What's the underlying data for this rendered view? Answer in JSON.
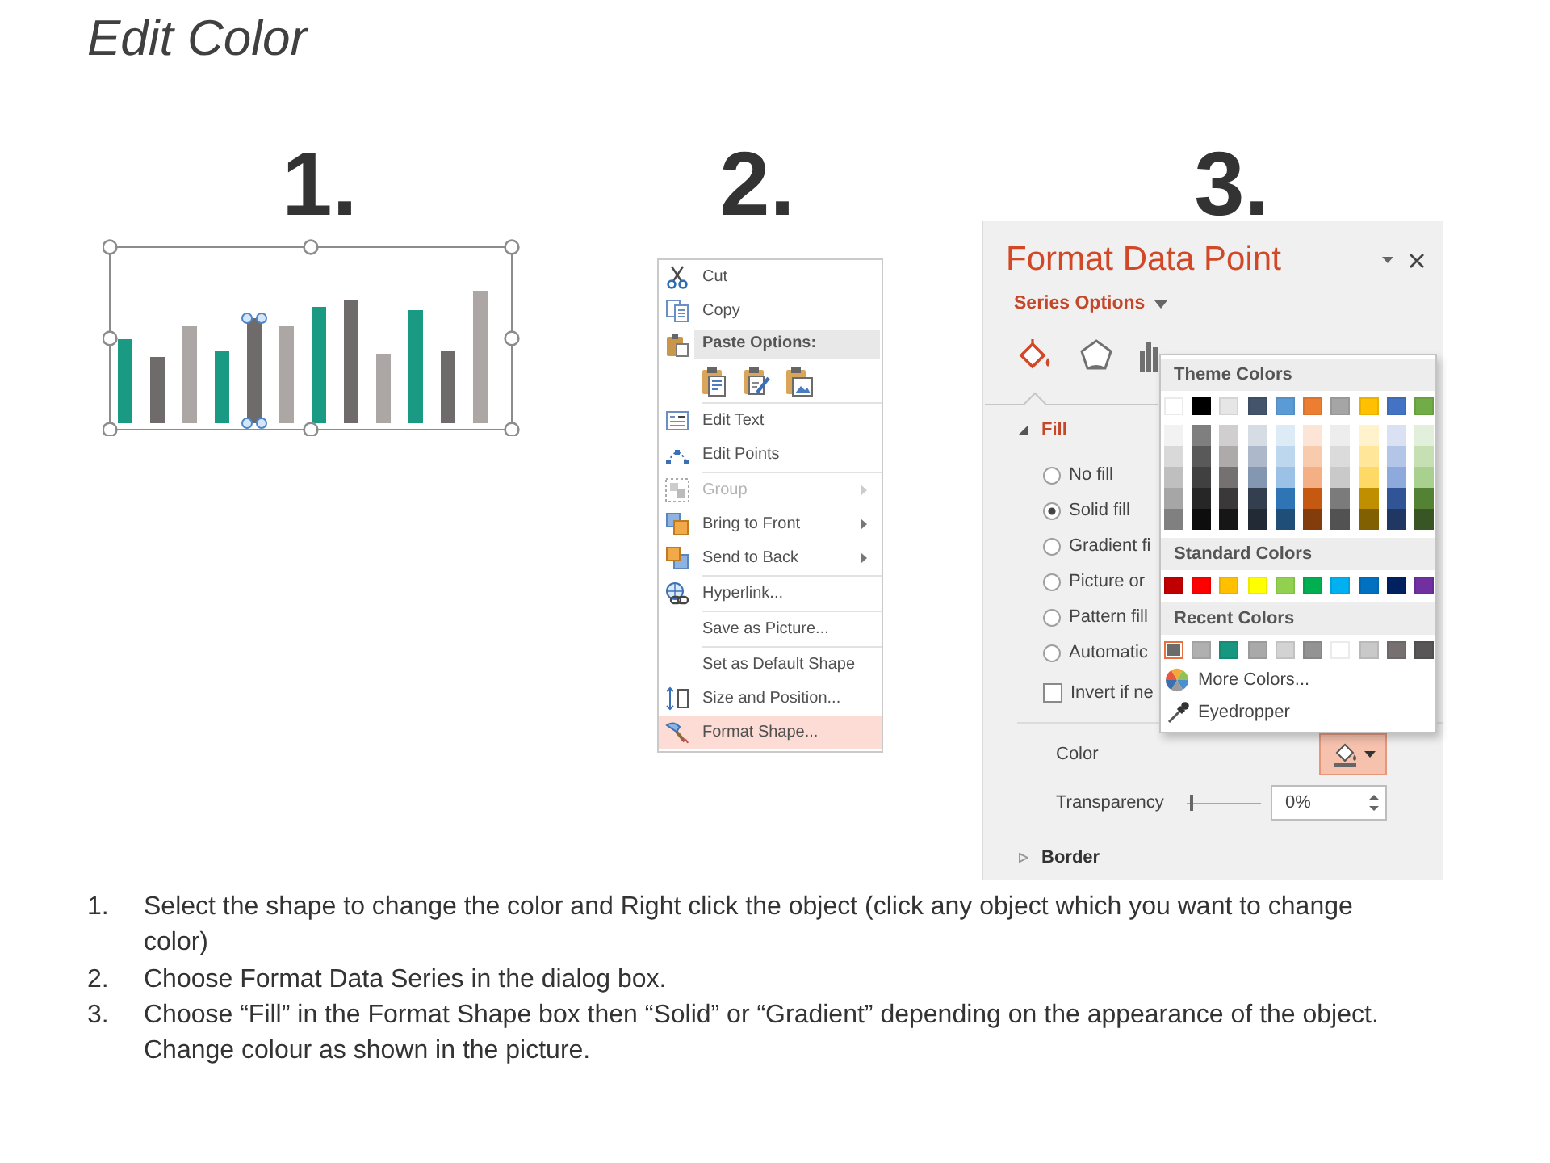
{
  "title": "Edit Color",
  "steps": [
    {
      "number": "1."
    },
    {
      "number": "2.",
      "context_menu": {
        "items": [
          {
            "kind": "item",
            "label": "Cut",
            "disabled": false,
            "submenu": false,
            "selected": false
          },
          {
            "kind": "item",
            "label": "Copy",
            "disabled": false,
            "submenu": false,
            "selected": false
          },
          {
            "kind": "header",
            "label": "Paste Options:"
          },
          {
            "kind": "paste_icons"
          },
          {
            "kind": "separator"
          },
          {
            "kind": "item",
            "label": "Edit Text",
            "disabled": false,
            "submenu": false,
            "selected": false
          },
          {
            "kind": "item",
            "label": "Edit Points",
            "disabled": false,
            "submenu": false,
            "selected": false
          },
          {
            "kind": "separator"
          },
          {
            "kind": "item",
            "label": "Group",
            "disabled": true,
            "submenu": true,
            "selected": false
          },
          {
            "kind": "item",
            "label": "Bring to Front",
            "disabled": false,
            "submenu": true,
            "selected": false
          },
          {
            "kind": "item",
            "label": "Send to Back",
            "disabled": false,
            "submenu": true,
            "selected": false
          },
          {
            "kind": "separator"
          },
          {
            "kind": "item",
            "label": "Hyperlink...",
            "disabled": false,
            "submenu": false,
            "selected": false
          },
          {
            "kind": "separator"
          },
          {
            "kind": "item",
            "label": "Save as Picture...",
            "disabled": false,
            "submenu": false,
            "selected": false
          },
          {
            "kind": "separator"
          },
          {
            "kind": "item",
            "label": "Set as Default Shape",
            "disabled": false,
            "submenu": false,
            "selected": false
          },
          {
            "kind": "item",
            "label": "Size and Position...",
            "disabled": false,
            "submenu": false,
            "selected": false
          },
          {
            "kind": "item",
            "label": "Format Shape...",
            "disabled": false,
            "submenu": false,
            "selected": true
          }
        ]
      }
    },
    {
      "number": "3.",
      "format_pane": {
        "title": "Format Data Point",
        "options_menu": "Series Options",
        "tabs": [
          {
            "selected": true
          },
          {
            "selected": false
          },
          {
            "selected": false
          }
        ],
        "fill": {
          "label": "Fill",
          "expanded": true,
          "options": [
            {
              "kind": "radio",
              "label": "No fill",
              "selected": false
            },
            {
              "kind": "radio",
              "label": "Solid fill",
              "selected": true
            },
            {
              "kind": "radio",
              "label": "Gradient fi",
              "selected": false
            },
            {
              "kind": "radio",
              "label": "Picture or",
              "selected": false
            },
            {
              "kind": "radio",
              "label": "Pattern fill",
              "selected": false
            },
            {
              "kind": "radio",
              "label": "Automatic",
              "selected": false
            },
            {
              "kind": "checkbox",
              "label": "Invert if ne",
              "checked": false
            }
          ],
          "color": {
            "label": "Color",
            "open": true,
            "menu": {
              "theme_colors": {
                "heading": "Theme Colors",
                "swatches": [
                  {
                    "color": "#ffffff",
                    "selected": false,
                    "shades": [
                      {
                        "color": "#f2f2f2",
                        "selected": false
                      },
                      {
                        "color": "#d9d9d9",
                        "selected": false
                      },
                      {
                        "color": "#bfbfbf",
                        "selected": false
                      },
                      {
                        "color": "#a6a6a6",
                        "selected": false
                      },
                      {
                        "color": "#808080",
                        "selected": false
                      }
                    ]
                  },
                  {
                    "color": "#000000",
                    "selected": false,
                    "shades": [
                      {
                        "color": "#7f7f7f",
                        "selected": false
                      },
                      {
                        "color": "#595959",
                        "selected": false
                      },
                      {
                        "color": "#404040",
                        "selected": false
                      },
                      {
                        "color": "#262626",
                        "selected": false
                      },
                      {
                        "color": "#0d0d0d",
                        "selected": false
                      }
                    ]
                  },
                  {
                    "color": "#e7e6e6",
                    "selected": false,
                    "shades": [
                      {
                        "color": "#d0cece",
                        "selected": false
                      },
                      {
                        "color": "#aeaaaa",
                        "selected": false
                      },
                      {
                        "color": "#757171",
                        "selected": false
                      },
                      {
                        "color": "#3a3838",
                        "selected": false
                      },
                      {
                        "color": "#171616",
                        "selected": false
                      }
                    ]
                  },
                  {
                    "color": "#44546a",
                    "selected": false,
                    "shades": [
                      {
                        "color": "#d6dce4",
                        "selected": false
                      },
                      {
                        "color": "#adb9ca",
                        "selected": false
                      },
                      {
                        "color": "#8497b0",
                        "selected": false
                      },
                      {
                        "color": "#333f4f",
                        "selected": false
                      },
                      {
                        "color": "#222a35",
                        "selected": false
                      }
                    ]
                  },
                  {
                    "color": "#5b9bd5",
                    "selected": false,
                    "shades": [
                      {
                        "color": "#ddebf7",
                        "selected": false
                      },
                      {
                        "color": "#bdd7ee",
                        "selected": false
                      },
                      {
                        "color": "#9bc2e6",
                        "selected": false
                      },
                      {
                        "color": "#2f75b5",
                        "selected": false
                      },
                      {
                        "color": "#1f4e78",
                        "selected": false
                      }
                    ]
                  },
                  {
                    "color": "#ed7d31",
                    "selected": false,
                    "shades": [
                      {
                        "color": "#fce4d6",
                        "selected": false
                      },
                      {
                        "color": "#f8cbad",
                        "selected": false
                      },
                      {
                        "color": "#f4b084",
                        "selected": false
                      },
                      {
                        "color": "#c65911",
                        "selected": false
                      },
                      {
                        "color": "#833c0c",
                        "selected": false
                      }
                    ]
                  },
                  {
                    "color": "#a5a5a5",
                    "selected": false,
                    "shades": [
                      {
                        "color": "#ededed",
                        "selected": false
                      },
                      {
                        "color": "#dbdbdb",
                        "selected": false
                      },
                      {
                        "color": "#c9c9c9",
                        "selected": false
                      },
                      {
                        "color": "#7b7b7b",
                        "selected": false
                      },
                      {
                        "color": "#525252",
                        "selected": false
                      }
                    ]
                  },
                  {
                    "color": "#ffc000",
                    "selected": false,
                    "shades": [
                      {
                        "color": "#fff2cc",
                        "selected": false
                      },
                      {
                        "color": "#ffe699",
                        "selected": false
                      },
                      {
                        "color": "#ffd966",
                        "selected": false
                      },
                      {
                        "color": "#bf8f00",
                        "selected": false
                      },
                      {
                        "color": "#806000",
                        "selected": false
                      }
                    ]
                  },
                  {
                    "color": "#4472c4",
                    "selected": false,
                    "shades": [
                      {
                        "color": "#d9e1f2",
                        "selected": false
                      },
                      {
                        "color": "#b4c6e7",
                        "selected": false
                      },
                      {
                        "color": "#8ea9db",
                        "selected": false
                      },
                      {
                        "color": "#305496",
                        "selected": false
                      },
                      {
                        "color": "#203764",
                        "selected": false
                      }
                    ]
                  },
                  {
                    "color": "#70ad47",
                    "selected": false,
                    "shades": [
                      {
                        "color": "#e2efda",
                        "selected": false
                      },
                      {
                        "color": "#c6e0b4",
                        "selected": false
                      },
                      {
                        "color": "#a9d08e",
                        "selected": false
                      },
                      {
                        "color": "#548235",
                        "selected": false
                      },
                      {
                        "color": "#375623",
                        "selected": false
                      }
                    ]
                  }
                ]
              },
              "standard_colors": {
                "heading": "Standard Colors",
                "swatches": [
                  {
                    "color": "#c00000",
                    "selected": false
                  },
                  {
                    "color": "#ff0000",
                    "selected": false
                  },
                  {
                    "color": "#ffc000",
                    "selected": false
                  },
                  {
                    "color": "#ffff00",
                    "selected": false
                  },
                  {
                    "color": "#92d050",
                    "selected": false
                  },
                  {
                    "color": "#00b050",
                    "selected": false
                  },
                  {
                    "color": "#00b0f0",
                    "selected": false
                  },
                  {
                    "color": "#0070c0",
                    "selected": false
                  },
                  {
                    "color": "#002060",
                    "selected": false
                  },
                  {
                    "color": "#7030a0",
                    "selected": false
                  }
                ]
              },
              "recent_colors": {
                "heading": "Recent Colors",
                "swatches": [
                  {
                    "color": "#6b6b6b",
                    "selected": true
                  },
                  {
                    "color": "#b0b0b0",
                    "selected": false
                  },
                  {
                    "color": "#17977f",
                    "selected": false
                  },
                  {
                    "color": "#a9a9a9",
                    "selected": false
                  },
                  {
                    "color": "#d3d3d3",
                    "selected": false
                  },
                  {
                    "color": "#939393",
                    "selected": false
                  },
                  {
                    "color": "#ffffff",
                    "selected": false
                  },
                  {
                    "color": "#c9c9c9",
                    "selected": false
                  },
                  {
                    "color": "#767170",
                    "selected": false
                  },
                  {
                    "color": "#585656",
                    "selected": false
                  }
                ]
              },
              "actions": [
                "More Colors...",
                "Eyedropper"
              ]
            }
          },
          "transparency": {
            "label": "Transparency",
            "level": 0,
            "value": "0%"
          }
        },
        "border": {
          "label": "Border",
          "expanded": false
        }
      }
    }
  ],
  "instructions": [
    {
      "number": "1.",
      "text": "Select the shape to change the color and Right click the object (click any object which you want to change color)"
    },
    {
      "number": "2.",
      "text": "Choose Format Data Series in the dialog box."
    },
    {
      "number": "3.",
      "text": "Choose “Fill” in the Format Shape box then “Solid” or “Gradient” depending on the appearance of the object. Change colour as shown in the picture."
    }
  ]
}
